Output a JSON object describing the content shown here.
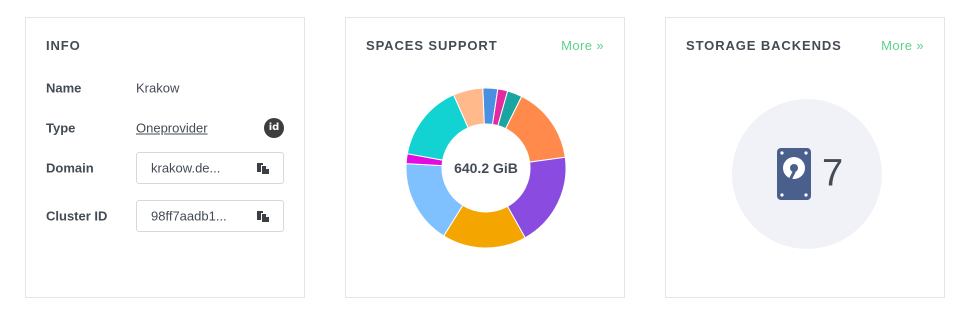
{
  "info": {
    "title": "INFO",
    "name_label": "Name",
    "name_value": "Krakow",
    "type_label": "Type",
    "type_value": "Oneprovider",
    "id_badge": "id",
    "domain_label": "Domain",
    "domain_value": "krakow.de...",
    "cluster_label": "Cluster ID",
    "cluster_value": "98ff7aadb1..."
  },
  "spaces": {
    "title": "SPACES SUPPORT",
    "more": "More »",
    "total": "640.2 GiB",
    "segments": [
      {
        "color": "#4a90e2",
        "fraction": 0.03
      },
      {
        "color": "#e52aa0",
        "fraction": 0.02
      },
      {
        "color": "#1aa5a0",
        "fraction": 0.03
      },
      {
        "color": "#ff8a4c",
        "fraction": 0.155
      },
      {
        "color": "#8a4be0",
        "fraction": 0.19
      },
      {
        "color": "#f5a500",
        "fraction": 0.17
      },
      {
        "color": "#7fc1ff",
        "fraction": 0.17
      },
      {
        "color": "#e20ce0",
        "fraction": 0.02
      },
      {
        "color": "#13d2d2",
        "fraction": 0.155
      },
      {
        "color": "#ffb98a",
        "fraction": 0.06
      }
    ]
  },
  "storage": {
    "title": "STORAGE BACKENDS",
    "more": "More »",
    "count": "7",
    "icon": "hard-drive-icon",
    "icon_color": "#4a5f8c"
  }
}
